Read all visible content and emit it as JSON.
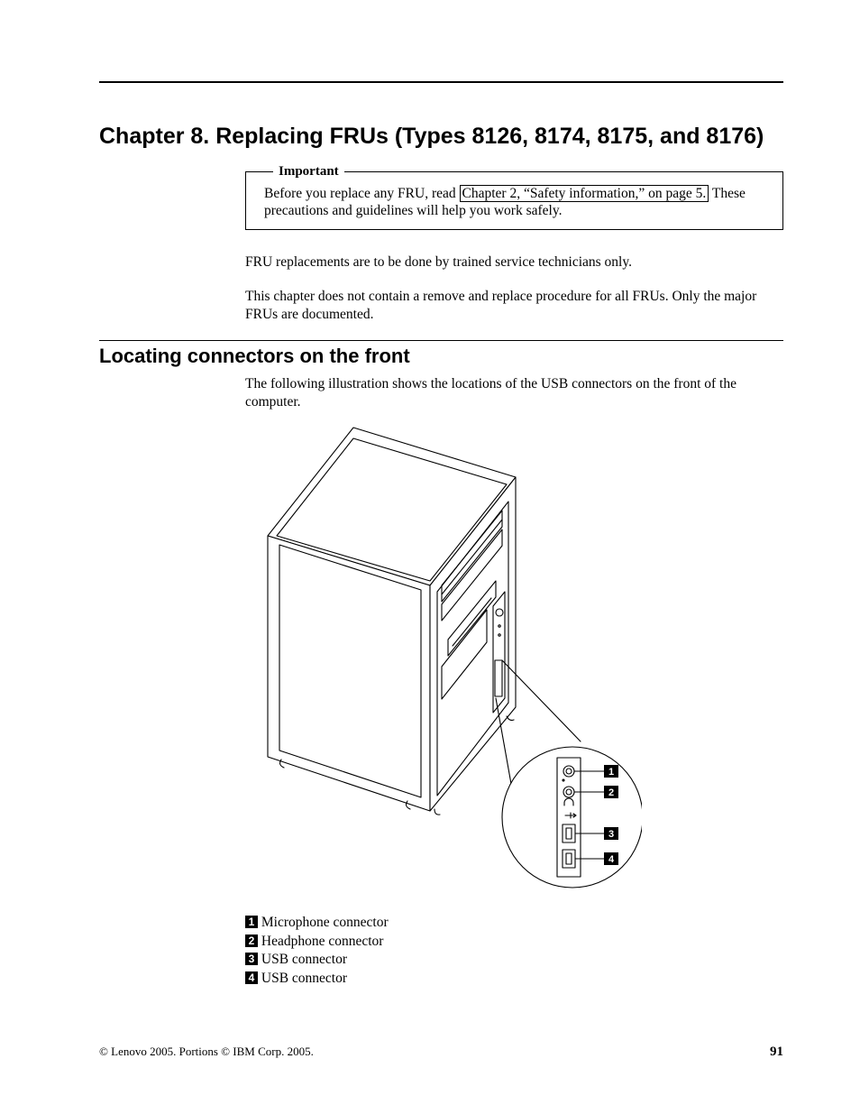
{
  "chapter_title": "Chapter 8. Replacing FRUs (Types 8126, 8174, 8175, and 8176)",
  "important_box": {
    "legend": "Important",
    "text_before_link": "Before you replace any FRU, read ",
    "link_text": "Chapter 2, “Safety information,” on page 5.",
    "text_after_link": " These precautions and guidelines will help you work safely."
  },
  "para1": "FRU replacements are to be done by trained service technicians only.",
  "para2": "This chapter does not contain a remove and replace procedure for all FRUs. Only the major FRUs are documented.",
  "section_title": "Locating connectors on the front",
  "section_intro": "The following illustration shows the locations of the USB connectors on the front of the computer.",
  "callouts": {
    "c1": "1",
    "c2": "2",
    "c3": "3",
    "c4": "4"
  },
  "key": {
    "k1_num": "1",
    "k1_label": "Microphone connector",
    "k2_num": "2",
    "k2_label": "Headphone connector",
    "k3_num": "3",
    "k3_label": "USB connector",
    "k4_num": "4",
    "k4_label": "USB connector"
  },
  "footer": {
    "copyright": "© Lenovo 2005. Portions © IBM Corp. 2005.",
    "page_number": "91"
  }
}
